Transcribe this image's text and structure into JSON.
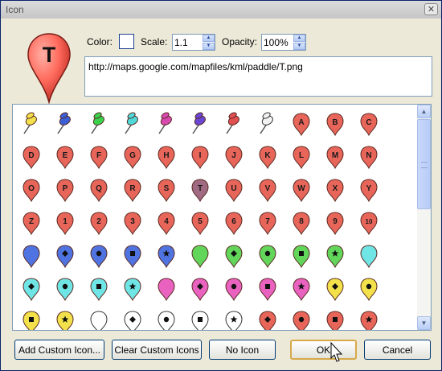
{
  "window": {
    "title": "Icon",
    "close_glyph": "✕"
  },
  "preview": {
    "letter": "T",
    "color": "#ff6b5d"
  },
  "properties": {
    "color_label": "Color:",
    "color_value": "#ffffff",
    "scale_label": "Scale:",
    "scale_value": "1.1",
    "opacity_label": "Opacity:",
    "opacity_value": "100%",
    "url": "http://maps.google.com/mapfiles/kml/paddle/T.png"
  },
  "icon_grid": {
    "rows": [
      [
        {
          "kind": "pushpin",
          "color": "#f2e14a"
        },
        {
          "kind": "pushpin",
          "color": "#3b5fd6"
        },
        {
          "kind": "pushpin",
          "color": "#3ad24c"
        },
        {
          "kind": "pushpin",
          "color": "#4fd9d9"
        },
        {
          "kind": "pushpin",
          "color": "#d94ab0"
        },
        {
          "kind": "pushpin",
          "color": "#6a47d2"
        },
        {
          "kind": "pushpin",
          "color": "#e05050"
        },
        {
          "kind": "pushpin",
          "color": "#f2f2f2"
        },
        {
          "kind": "paddle",
          "color": "#e8655a",
          "label": "A"
        },
        {
          "kind": "paddle",
          "color": "#e8655a",
          "label": "B"
        },
        {
          "kind": "paddle",
          "color": "#e8655a",
          "label": "C"
        }
      ],
      [
        {
          "kind": "paddle",
          "color": "#e8655a",
          "label": "D"
        },
        {
          "kind": "paddle",
          "color": "#e8655a",
          "label": "E"
        },
        {
          "kind": "paddle",
          "color": "#e8655a",
          "label": "F"
        },
        {
          "kind": "paddle",
          "color": "#e8655a",
          "label": "G"
        },
        {
          "kind": "paddle",
          "color": "#e8655a",
          "label": "H"
        },
        {
          "kind": "paddle",
          "color": "#e8655a",
          "label": "I"
        },
        {
          "kind": "paddle",
          "color": "#e8655a",
          "label": "J"
        },
        {
          "kind": "paddle",
          "color": "#e8655a",
          "label": "K"
        },
        {
          "kind": "paddle",
          "color": "#e8655a",
          "label": "L"
        },
        {
          "kind": "paddle",
          "color": "#e8655a",
          "label": "M"
        },
        {
          "kind": "paddle",
          "color": "#e8655a",
          "label": "N"
        }
      ],
      [
        {
          "kind": "paddle",
          "color": "#e8655a",
          "label": "O"
        },
        {
          "kind": "paddle",
          "color": "#e8655a",
          "label": "P"
        },
        {
          "kind": "paddle",
          "color": "#e8655a",
          "label": "Q"
        },
        {
          "kind": "paddle",
          "color": "#e8655a",
          "label": "R"
        },
        {
          "kind": "paddle",
          "color": "#e8655a",
          "label": "S"
        },
        {
          "kind": "paddle",
          "color": "#a06a82",
          "label": "T"
        },
        {
          "kind": "paddle",
          "color": "#e8655a",
          "label": "U"
        },
        {
          "kind": "paddle",
          "color": "#e8655a",
          "label": "V"
        },
        {
          "kind": "paddle",
          "color": "#e8655a",
          "label": "W"
        },
        {
          "kind": "paddle",
          "color": "#e8655a",
          "label": "X"
        },
        {
          "kind": "paddle",
          "color": "#e8655a",
          "label": "Y"
        }
      ],
      [
        {
          "kind": "paddle",
          "color": "#e8655a",
          "label": "Z"
        },
        {
          "kind": "paddle",
          "color": "#e8655a",
          "label": "1"
        },
        {
          "kind": "paddle",
          "color": "#e8655a",
          "label": "2"
        },
        {
          "kind": "paddle",
          "color": "#e8655a",
          "label": "3"
        },
        {
          "kind": "paddle",
          "color": "#e8655a",
          "label": "4"
        },
        {
          "kind": "paddle",
          "color": "#e8655a",
          "label": "5"
        },
        {
          "kind": "paddle",
          "color": "#e8655a",
          "label": "6"
        },
        {
          "kind": "paddle",
          "color": "#e8655a",
          "label": "7"
        },
        {
          "kind": "paddle",
          "color": "#e8655a",
          "label": "8"
        },
        {
          "kind": "paddle",
          "color": "#e8655a",
          "label": "9"
        },
        {
          "kind": "paddle",
          "color": "#e8655a",
          "label": "10"
        }
      ],
      [
        {
          "kind": "paddle",
          "color": "#4f73e0",
          "shape": "none"
        },
        {
          "kind": "paddle",
          "color": "#4f73e0",
          "shape": "diamond"
        },
        {
          "kind": "paddle",
          "color": "#4f73e0",
          "shape": "circle"
        },
        {
          "kind": "paddle",
          "color": "#4f73e0",
          "shape": "square"
        },
        {
          "kind": "paddle",
          "color": "#4f73e0",
          "shape": "star"
        },
        {
          "kind": "paddle",
          "color": "#62d65a",
          "shape": "none"
        },
        {
          "kind": "paddle",
          "color": "#62d65a",
          "shape": "diamond"
        },
        {
          "kind": "paddle",
          "color": "#62d65a",
          "shape": "circle"
        },
        {
          "kind": "paddle",
          "color": "#62d65a",
          "shape": "square"
        },
        {
          "kind": "paddle",
          "color": "#62d65a",
          "shape": "star"
        },
        {
          "kind": "paddle",
          "color": "#6fe5e5",
          "shape": "none"
        }
      ],
      [
        {
          "kind": "paddle",
          "color": "#6fe5e5",
          "shape": "diamond"
        },
        {
          "kind": "paddle",
          "color": "#6fe5e5",
          "shape": "circle"
        },
        {
          "kind": "paddle",
          "color": "#6fe5e5",
          "shape": "square"
        },
        {
          "kind": "paddle",
          "color": "#6fe5e5",
          "shape": "star"
        },
        {
          "kind": "paddle",
          "color": "#ea62c0",
          "shape": "none"
        },
        {
          "kind": "paddle",
          "color": "#ea62c0",
          "shape": "diamond"
        },
        {
          "kind": "paddle",
          "color": "#ea62c0",
          "shape": "circle"
        },
        {
          "kind": "paddle",
          "color": "#ea62c0",
          "shape": "square"
        },
        {
          "kind": "paddle",
          "color": "#ea62c0",
          "shape": "star"
        },
        {
          "kind": "paddle",
          "color": "#f2e14a",
          "shape": "diamond"
        },
        {
          "kind": "paddle",
          "color": "#f2e14a",
          "shape": "circle"
        }
      ],
      [
        {
          "kind": "paddle",
          "color": "#f2e14a",
          "shape": "square"
        },
        {
          "kind": "paddle",
          "color": "#f2e14a",
          "shape": "star"
        },
        {
          "kind": "paddle",
          "color": "#ffffff",
          "shape": "none"
        },
        {
          "kind": "paddle",
          "color": "#ffffff",
          "shape": "diamond"
        },
        {
          "kind": "paddle",
          "color": "#ffffff",
          "shape": "circle"
        },
        {
          "kind": "paddle",
          "color": "#ffffff",
          "shape": "square"
        },
        {
          "kind": "paddle",
          "color": "#ffffff",
          "shape": "star"
        },
        {
          "kind": "paddle",
          "color": "#e8655a",
          "shape": "diamond"
        },
        {
          "kind": "paddle",
          "color": "#e8655a",
          "shape": "circle"
        },
        {
          "kind": "paddle",
          "color": "#e8655a",
          "shape": "square"
        },
        {
          "kind": "paddle",
          "color": "#e8655a",
          "shape": "star"
        }
      ],
      [
        {
          "kind": "paddle",
          "color": "#9a7fd8",
          "shape": "none"
        },
        {
          "kind": "paddle",
          "color": "#9a7fd8",
          "shape": "none"
        },
        {
          "kind": "paddle",
          "color": "#9a7fd8",
          "shape": "none"
        },
        {
          "kind": "paddle",
          "color": "#9a7fd8",
          "shape": "none"
        },
        {
          "kind": "paddle",
          "color": "#ffffff",
          "shape": "none"
        },
        {
          "kind": "paddle",
          "color": "#ffffff",
          "shape": "none"
        },
        {
          "kind": "paddle",
          "color": "#ffffff",
          "shape": "none"
        },
        {
          "kind": "paddle",
          "color": "#ffffff",
          "shape": "none"
        },
        {
          "kind": "paddle",
          "color": "#ffffff",
          "shape": "none"
        },
        {
          "kind": "paddle",
          "color": "#ffffff",
          "shape": "none"
        },
        {
          "kind": "paddle",
          "color": "#ffffff",
          "shape": "none"
        }
      ]
    ]
  },
  "buttons": {
    "add_custom": "Add Custom Icon...",
    "clear_custom": "Clear Custom Icons",
    "no_icon": "No Icon",
    "ok": "OK",
    "cancel": "Cancel"
  }
}
